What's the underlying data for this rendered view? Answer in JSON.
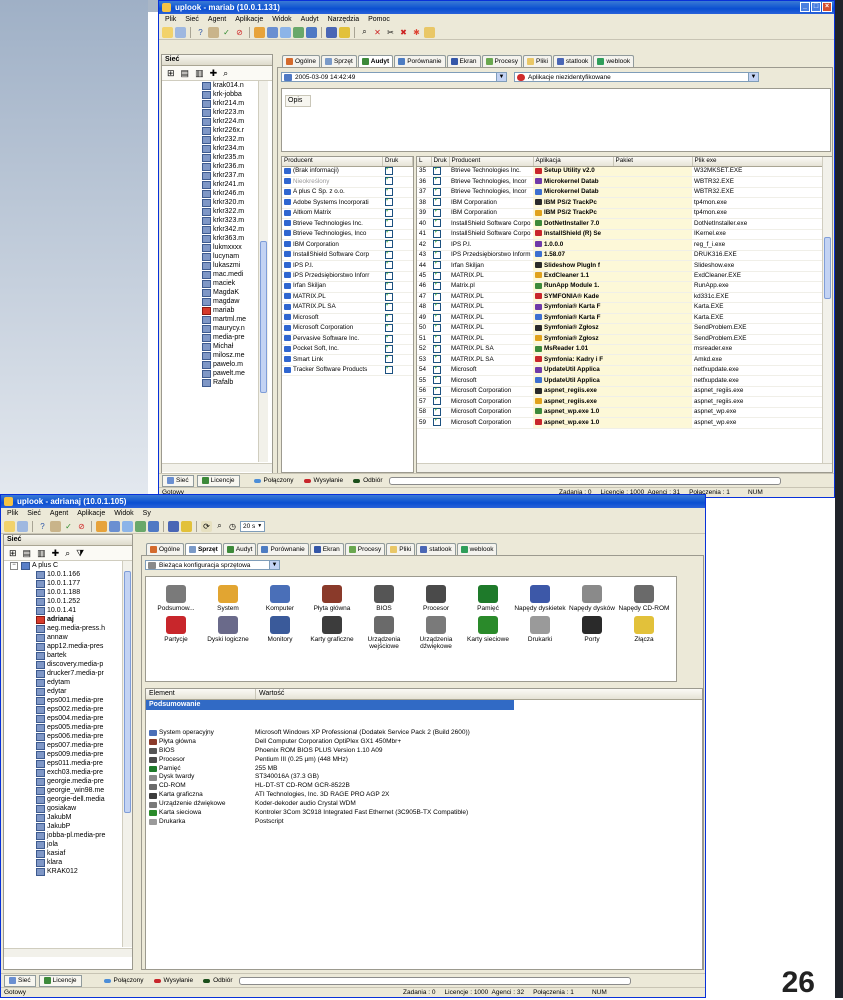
{
  "page_number": "26",
  "top": {
    "title": "uplook - mariab (10.0.1.131)",
    "menu": [
      "Plik",
      "Sieć",
      "Agent",
      "Aplikacje",
      "Widok",
      "Audyt",
      "Narzędzia",
      "Pomoc"
    ],
    "panel_title": "Sieć",
    "tree": [
      "krak014.n",
      "krk-jobba",
      "krkr214.m",
      "krkr223.m",
      "krkr224.m",
      "krkr226x.r",
      "krkr232.m",
      "krkr234.m",
      "krkr235.m",
      "krkr236.m",
      "krkr237.m",
      "krkr241.m",
      "krkr246.m",
      "krkr320.m",
      "krkr322.m",
      "krkr323.m",
      "krkr342.m",
      "krkr363.m",
      "lukmxxxx",
      "lucynam",
      "lukaszmi",
      "mac.medi",
      "maciek",
      "MagdaK",
      "magdaw",
      "mariab",
      "martml.me",
      "maurycy.n",
      "media-pre",
      "Michał",
      "milosz.me",
      "pawelo.m",
      "pawelt.me",
      "Rafalb"
    ],
    "tabs": [
      "Ogólne",
      "Sprzęt",
      "Audyt",
      "Porównanie",
      "Ekran",
      "Procesy",
      "Pliki",
      "statlook",
      "weblook"
    ],
    "date_combo": "2005-03-09 14:42:49",
    "filter_combo": "Aplikacje niezidentyfikowane",
    "opis_label": "Opis",
    "producers_cols": [
      "Producent",
      "Druk"
    ],
    "producers": [
      "(Brak informacji)",
      "Nieokreślony",
      "A plus C Sp. z o.o.",
      "Adobe Systems Incorporati",
      "Altkom Matrix",
      "Btrieve Technologies Inc.",
      "Btrieve Technologies, Inco",
      "IBM Corporation",
      "InstallShield Software Corp",
      "IPS P.I.",
      "IPS Przedsiębiorstwo Inforr",
      "Irfan Skiljan",
      "MATRIX.PL",
      "MATRIX.PL SA",
      "Microsoft",
      "Microsoft Corporation",
      "Pervasive Software Inc.",
      "Pocket Soft, Inc.",
      "Smart Link",
      "Tracker Software Products"
    ],
    "apps_cols": [
      "L",
      "Druk",
      "Producent",
      "Aplikacja",
      "Pakiet",
      "Plik exe"
    ],
    "apps": [
      [
        "35",
        "Btrieve Technologies Inc.",
        "Setup Utility v2.0",
        "W32MKSET.EXE"
      ],
      [
        "36",
        "Btrieve Technologies, Incor",
        "Microkernel Datab",
        "WBTR32.EXE"
      ],
      [
        "37",
        "Btrieve Technologies, Incor",
        "Microkernel Datab",
        "WBTR32.EXE"
      ],
      [
        "38",
        "IBM Corporation",
        "IBM PS/2 TrackPc",
        "tp4mon.exe"
      ],
      [
        "39",
        "IBM Corporation",
        "IBM PS/2 TrackPc",
        "tp4mon.exe"
      ],
      [
        "40",
        "InstallShield Software Corpo",
        "DotNetInstaller 7.0",
        "DotNetInstaller.exe"
      ],
      [
        "41",
        "InstallShield Software Corpo",
        "InstallShield (R) Se",
        "IKernel.exe"
      ],
      [
        "42",
        "IPS P.I.",
        "1.0.0.0",
        "reg_f_i.exe"
      ],
      [
        "43",
        "IPS Przedsiębiorstwo Inform",
        "1.58.07",
        "DRUK316.EXE"
      ],
      [
        "44",
        "Irfan Skiljan",
        "Slideshow PlugIn f",
        "Slideshow.exe"
      ],
      [
        "45",
        "MATRIX.PL",
        "ExdCleaner 1.1",
        "ExdCleaner.EXE"
      ],
      [
        "46",
        "Matrix.pl",
        "RunApp Module 1.",
        "RunApp.exe"
      ],
      [
        "47",
        "MATRIX.PL",
        "SYMFONIA® Kade",
        "kd331c.EXE"
      ],
      [
        "48",
        "MATRIX.PL",
        "Symfonia® Karta F",
        "Karta.EXE"
      ],
      [
        "49",
        "MATRIX.PL",
        "Symfonia® Karta F",
        "Karta.EXE"
      ],
      [
        "50",
        "MATRIX.PL",
        "Symfonia® Zgłosz",
        "SendProblem.EXE"
      ],
      [
        "51",
        "MATRIX.PL",
        "Symfonia® Zgłosz",
        "SendProblem.EXE"
      ],
      [
        "52",
        "MATRIX.PL SA",
        "MsReader 1.01",
        "msreader.exe"
      ],
      [
        "53",
        "MATRIX.PL SA",
        "Symfonia: Kadry i F",
        "Amkd.exe"
      ],
      [
        "54",
        "Microsoft",
        "UpdateUtil Applica",
        "netfxupdate.exe"
      ],
      [
        "55",
        "Microsoft",
        "UpdateUtil Applica",
        "netfxupdate.exe"
      ],
      [
        "56",
        "Microsoft Corporation",
        "aspnet_regiis.exe",
        "aspnet_regiis.exe"
      ],
      [
        "57",
        "Microsoft Corporation",
        "aspnet_regiis.exe",
        "aspnet_regiis.exe"
      ],
      [
        "58",
        "Microsoft Corporation",
        "aspnet_wp.exe 1.0",
        "aspnet_wp.exe"
      ],
      [
        "59",
        "Microsoft Corporation",
        "aspnet_wp.exe 1.0",
        "aspnet_wp.exe"
      ]
    ],
    "bottom_tabs": [
      "Sieć",
      "Licencje"
    ],
    "legend": [
      "Połączony",
      "Wysyłanie",
      "Odbiór"
    ],
    "status_left": "Gotowy",
    "status_right": "Zadania : 0     Licencje : 1000  Agenci : 31     Połączenia : 1          NUM"
  },
  "bottom": {
    "title": "uplook - adrianaj (10.0.1.105)",
    "menu": [
      "Plik",
      "Sieć",
      "Agent",
      "Aplikacje",
      "Widok",
      "Sy"
    ],
    "timer": "20 s",
    "panel_title": "Sieć",
    "tree_root": "A plus C",
    "tree": [
      "10.0.1.166",
      "10.0.1.177",
      "10.0.1.188",
      "10.0.1.252",
      "10.0.1.41",
      "adrianaj",
      "aeg.media-press.h",
      "annaw",
      "app12.media-pres",
      "bartek",
      "discovery.media-p",
      "drucker7.media-pr",
      "edytam",
      "edytar",
      "eps001.media-pre",
      "eps002.media-pre",
      "eps004.media-pre",
      "eps005.media-pre",
      "eps006.media-pre",
      "eps007.media-pre",
      "eps009.media-pre",
      "eps011.media-pre",
      "exch03.media-pre",
      "georgie.media-pre",
      "georgie_win98.me",
      "georgie-dell.media",
      "gosiakaw",
      "JakubM",
      "JakubP",
      "jobba-pl.media-pre",
      "jola",
      "kasiaf",
      "klara",
      "KRAK012"
    ],
    "tabs": [
      "Ogólne",
      "Sprzęt",
      "Audyt",
      "Porównanie",
      "Ekran",
      "Procesy",
      "Pliki",
      "statlook",
      "weblook"
    ],
    "config_combo": "Bieżąca konfiguracja sprzętowa",
    "hw_row1": [
      "Podsumow...",
      "System",
      "Komputer",
      "Płyta główna",
      "BIOS",
      "Procesor",
      "Pamięć",
      "Napędy dyskietek",
      "Napędy dysków",
      "Napędy CD-ROM"
    ],
    "hw_row2": [
      "Partycje",
      "Dyski logiczne",
      "Monitory",
      "Karty graficzne",
      "Urządzenia wejściowe",
      "Urządzenia dźwiękowe",
      "Karty sieciowe",
      "Drukarki",
      "Porty",
      "Złącza"
    ],
    "cols": [
      "Element",
      "Wartość"
    ],
    "summary_header": "Podsumowanie",
    "summary": [
      [
        "System operacyjny",
        "Microsoft Windows XP Professional (Dodatek Service Pack 2 (Build 2600))"
      ],
      [
        "Płyta główna",
        "Dell Computer Corporation OptiPlex GX1 450Mbr+"
      ],
      [
        "BIOS",
        "Phoenix ROM BIOS PLUS Version 1.10 A09"
      ],
      [
        "Procesor",
        "Pentium III (0.25 µm) (448 MHz)"
      ],
      [
        "Pamięć",
        "255 MB"
      ],
      [
        "Dysk twardy",
        "ST340016A (37.3 GB)"
      ],
      [
        "CD-ROM",
        "HL-DT-ST CD-ROM GCR-8522B"
      ],
      [
        "Karta graficzna",
        "ATI Technologies, Inc. 3D RAGE PRO AGP 2X"
      ],
      [
        "Urządzenie dźwiękowe",
        "Koder-dekoder audio Crystal WDM"
      ],
      [
        "Karta sieciowa",
        "Kontroler 3Com 3C918 Integrated Fast Ethernet (3C905B-TX Compatible)"
      ],
      [
        "Drukarka",
        "Postscript"
      ]
    ],
    "bottom_tabs": [
      "Sieć",
      "Licencje"
    ],
    "legend": [
      "Połączony",
      "Wysyłanie",
      "Odbiór"
    ],
    "status_left": "Gotowy",
    "status_right": "Zadania : 0     Licencje : 1000  Agenci : 32     Połączenia : 1          NUM"
  }
}
